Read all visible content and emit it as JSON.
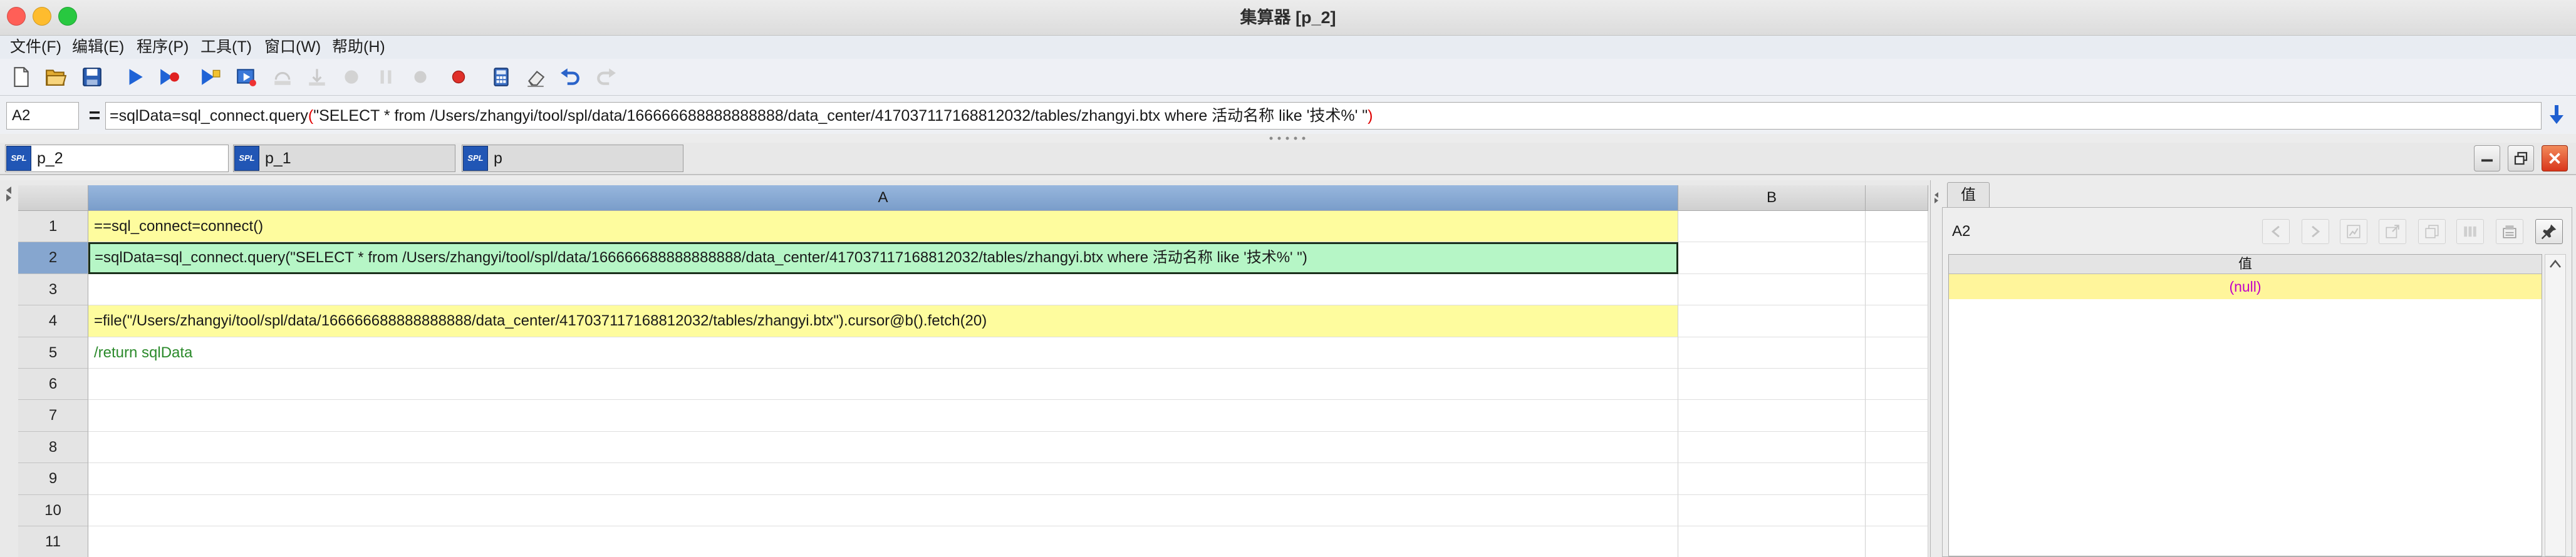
{
  "window": {
    "title": "集算器 [p_2]"
  },
  "menu": {
    "items": [
      "文件(F)",
      "编辑(E)",
      "程序(P)",
      "工具(T)",
      "窗口(W)",
      "帮助(H)"
    ]
  },
  "toolbar": {
    "icons": [
      "new-file-icon",
      "open-folder-icon",
      "save-icon",
      "run-icon",
      "debug-run-icon",
      "run-to-cursor-icon",
      "step-icon",
      "step-over-icon",
      "step-into-icon",
      "suspend-icon",
      "pause-icon",
      "stop-icon",
      "breakpoint-icon",
      "calculator-icon",
      "eraser-icon",
      "undo-icon",
      "redo-icon"
    ]
  },
  "formula_bar": {
    "cell_name": "A2",
    "equals": "=",
    "parts": [
      "=sqlData=sql_connect.query",
      "(",
      "\"SELECT * from /Users/zhangyi/tool/spl/data/166666688888888888/data_center/417037117168812032/tables/zhangyi.btx where 活动名称 like '技术%' \"",
      ")"
    ],
    "icons": [
      "expand-down-icon"
    ]
  },
  "tabs": [
    {
      "badge": "SPL",
      "label": "p_2"
    },
    {
      "badge": "SPL",
      "label": "p_1"
    },
    {
      "badge": "SPL",
      "label": "p"
    }
  ],
  "window_buttons": {
    "icons": [
      "minimize-icon",
      "restore-icon",
      "close-icon"
    ]
  },
  "grid": {
    "columns": [
      "A",
      "B"
    ],
    "rows": [
      {
        "num": "1",
        "a": "==sql_connect=connect()"
      },
      {
        "num": "2",
        "a": "=sqlData=sql_connect.query(\"SELECT * from /Users/zhangyi/tool/spl/data/166666688888888888/data_center/417037117168812032/tables/zhangyi.btx where 活动名称 like '技术%' \")"
      },
      {
        "num": "3",
        "a": ""
      },
      {
        "num": "4",
        "a": "=file(\"/Users/zhangyi/tool/spl/data/166666688888888888/data_center/417037117168812032/tables/zhangyi.btx\").cursor@b().fetch(20)"
      },
      {
        "num": "5",
        "a": "/return sqlData"
      },
      {
        "num": "6",
        "a": ""
      },
      {
        "num": "7",
        "a": ""
      },
      {
        "num": "8",
        "a": ""
      },
      {
        "num": "9",
        "a": ""
      },
      {
        "num": "10",
        "a": ""
      },
      {
        "num": "11",
        "a": ""
      }
    ]
  },
  "side_panel": {
    "tab": "值",
    "cell_name": "A2",
    "column_header": "值",
    "value": "(null)",
    "icons": [
      "back-icon",
      "forward-icon",
      "chart-icon",
      "export-icon",
      "copy-icon",
      "columns-icon",
      "format-icon",
      "pin-icon"
    ]
  },
  "colors": {
    "constant_cell": "#fefc9e",
    "executable_cell": "#b6f6c6",
    "comment_text": "#2b8a2b",
    "active_header": "#86a6cf",
    "null_value_text": "#c200c8",
    "null_value_bg": "#fff59b",
    "bracket_match": "#e00000"
  }
}
